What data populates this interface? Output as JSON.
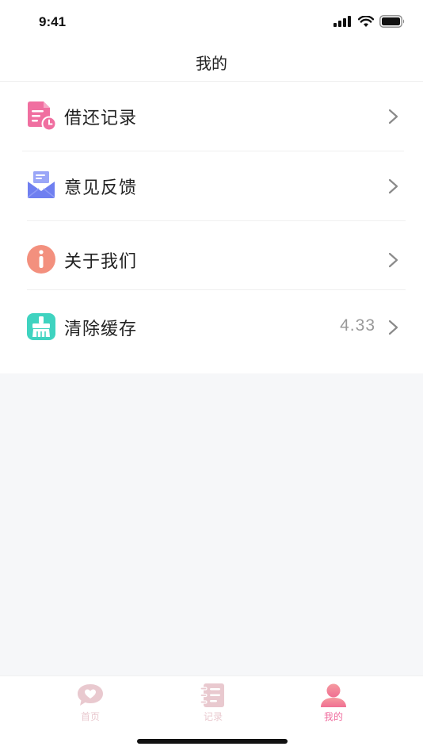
{
  "status_bar": {
    "time": "9:41",
    "icons": [
      "cellular-signal-icon",
      "wifi-icon",
      "battery-icon"
    ]
  },
  "nav": {
    "title": "我的"
  },
  "menu": {
    "items": [
      {
        "label": "借还记录",
        "icon": "record-document-clock-icon",
        "value": ""
      },
      {
        "label": "意见反馈",
        "icon": "feedback-envelope-icon",
        "value": ""
      },
      {
        "label": "关于我们",
        "icon": "info-circle-icon",
        "value": ""
      },
      {
        "label": "清除缓存",
        "icon": "clear-cache-brush-icon",
        "value": "4.33"
      }
    ]
  },
  "tabs": [
    {
      "label": "首页",
      "icon": "home-heart-bubble-icon",
      "active": false
    },
    {
      "label": "记录",
      "icon": "notebook-list-icon",
      "active": false
    },
    {
      "label": "我的",
      "icon": "user-profile-icon",
      "active": true
    }
  ],
  "colors": {
    "accent_pink": "#f06fa0",
    "tab_inactive": "#e9c9cf",
    "feedback_blue": "#6f7ff0",
    "info_salmon": "#f3907e",
    "cache_teal": "#3fd3c0",
    "background": "#f6f7f9"
  }
}
